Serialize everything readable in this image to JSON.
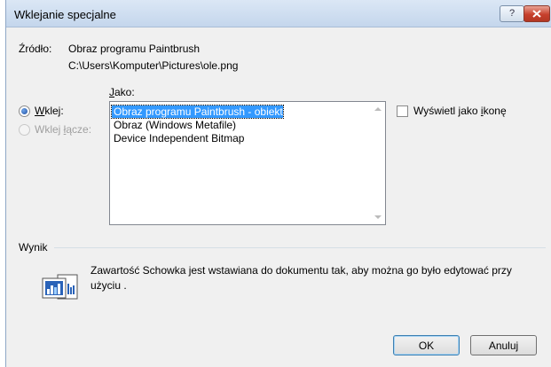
{
  "window": {
    "title": "Wklejanie specjalne",
    "help_label": "?"
  },
  "source": {
    "label": "Źródło:",
    "value": "Obraz programu Paintbrush",
    "path": "C:\\Users\\Komputer\\Pictures\\ole.png"
  },
  "jako": {
    "label": "Jako:"
  },
  "paste_options": [
    {
      "label": "Wklej:",
      "checked": true,
      "enabled": true
    },
    {
      "label": "Wklej łącze:",
      "checked": false,
      "enabled": false
    }
  ],
  "formats": [
    {
      "label": "Obraz programu Paintbrush - obiekt",
      "selected": true
    },
    {
      "label": "Obraz (Windows Metafile)",
      "selected": false
    },
    {
      "label": "Device Independent Bitmap",
      "selected": false
    }
  ],
  "display_as_icon": {
    "label": "Wyświetl jako ikonę",
    "checked": false
  },
  "result": {
    "label": "Wynik",
    "text": "Zawartość Schowka jest wstawiana do dokumentu tak, aby można go było edytować przy użyciu ."
  },
  "buttons": {
    "ok": "OK",
    "cancel": "Anuluj"
  },
  "colors": {
    "selection": "#3399ff",
    "close": "#c7402c",
    "title_bar": "#c4d6ec"
  }
}
